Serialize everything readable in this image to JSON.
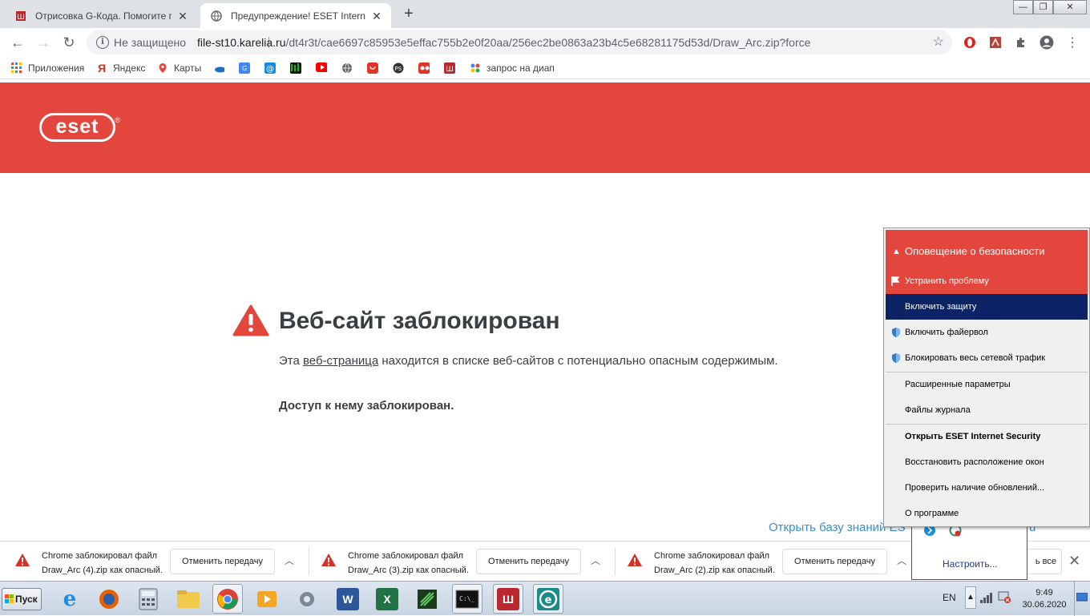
{
  "browser": {
    "tabs": [
      {
        "title": "Отрисовка G-Кода. Помогите прав",
        "active": false
      },
      {
        "title": "Предупреждение! ESET Internet Se",
        "active": true
      }
    ],
    "new_tab": "+",
    "window_controls": {
      "minimize": "—",
      "restore": "❐",
      "close": "✕"
    },
    "omnibox": {
      "security_label": "Не защищено",
      "url_host": "file-st10.karelia.ru",
      "url_path": "/dt4r3t/cae6697c85953e5effac755b2e0f20aa/256ec2be0863a23b4c5e68281175d53d/Draw_Arc.zip?force"
    },
    "bookmarks": [
      {
        "label": "Приложения",
        "icon": "apps-grid-icon"
      },
      {
        "label": "Яндекс",
        "icon": "yandex-icon"
      },
      {
        "label": "Карты",
        "icon": "maps-pin-icon"
      },
      {
        "label": "",
        "icon": "onedrive-icon"
      },
      {
        "label": "",
        "icon": "translate-icon"
      },
      {
        "label": "",
        "icon": "mail-icon"
      },
      {
        "label": "",
        "icon": "matrix-icon"
      },
      {
        "label": "",
        "icon": "youtube-icon"
      },
      {
        "label": "",
        "icon": "globe-icon"
      },
      {
        "label": "",
        "icon": "aliexpress-icon"
      },
      {
        "label": "",
        "icon": "ps-icon"
      },
      {
        "label": "",
        "icon": "quiz-icon"
      },
      {
        "label": "",
        "icon": "mi-icon"
      },
      {
        "label": "запрос на диап",
        "icon": "dots-icon"
      }
    ]
  },
  "page": {
    "logo_text": "eset",
    "logo_mark": "®",
    "title": "Веб-сайт заблокирован",
    "desc_before": "Эта ",
    "desc_link": "веб-страница",
    "desc_after": " находится в списке веб-сайтов с потенциально опасным содержимым.",
    "access": "Доступ к нему заблокирован.",
    "kb_link": "Открыть базу знаний ES",
    "kb_link_tail": "ru"
  },
  "downloads": [
    {
      "line1": "Chrome заблокировал файл",
      "line2": "Draw_Arc (4).zip как опасный.",
      "button": "Отменить передачу"
    },
    {
      "line1": "Chrome заблокировал файл",
      "line2": "Draw_Arc (3).zip как опасный.",
      "button": "Отменить передачу"
    },
    {
      "line1": "Chrome заблокировал файл",
      "line2": "Draw_Arc (2).zip как опасный.",
      "button": "Отменить передачу"
    }
  ],
  "show_all": "ь все",
  "tray_popup": {
    "configure": "Настроить..."
  },
  "context_menu": {
    "header": "Оповещение о безопасности",
    "items": [
      {
        "label": "Устранить проблему",
        "icon": "flag-icon",
        "style": "header"
      },
      {
        "label": "Включить защиту",
        "style": "selected"
      },
      {
        "label": "Включить файервол",
        "icon": "shield-icon"
      },
      {
        "label": "Блокировать весь сетевой трафик",
        "icon": "shield-icon"
      },
      {
        "label": "Расширенные параметры"
      },
      {
        "label": "Файлы журнала"
      },
      {
        "label": "Открыть ESET Internet Security",
        "style": "bold"
      },
      {
        "label": "Восстановить расположение окон"
      },
      {
        "label": "Проверить наличие обновлений..."
      },
      {
        "label": "О программе"
      }
    ]
  },
  "taskbar": {
    "start": "Пуск",
    "apps": [
      "ie-icon",
      "firefox-icon",
      "calculator-icon",
      "explorer-icon",
      "chrome-icon",
      "media-icon",
      "settings-icon",
      "word-icon",
      "excel-icon",
      "sketchup-icon",
      "cmd-icon",
      "mi-icon",
      "eset-icon"
    ],
    "lang": "EN",
    "time": "9:49",
    "date": "30.06.2020"
  },
  "colors": {
    "eset_red": "#e2463d",
    "menu_selected": "#0c2466",
    "link_blue": "#3a8fc6"
  }
}
